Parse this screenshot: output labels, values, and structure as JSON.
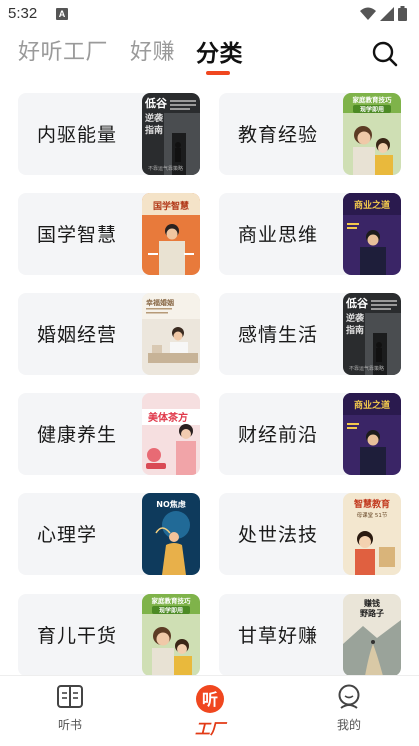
{
  "status": {
    "time": "5:32",
    "notif": "A"
  },
  "nav": {
    "tabs": [
      {
        "label": "好听工厂"
      },
      {
        "label": "好赚"
      },
      {
        "label": "分类"
      }
    ]
  },
  "categories": [
    {
      "label": "内驱能量",
      "cover": "low-valley"
    },
    {
      "label": "教育经验",
      "cover": "family-edu"
    },
    {
      "label": "国学智慧",
      "cover": "classics"
    },
    {
      "label": "商业思维",
      "cover": "business"
    },
    {
      "label": "婚姻经营",
      "cover": "couple"
    },
    {
      "label": "感情生活",
      "cover": "low-valley"
    },
    {
      "label": "健康养生",
      "cover": "beauty-tea"
    },
    {
      "label": "财经前沿",
      "cover": "business"
    },
    {
      "label": "心理学",
      "cover": "no-anxiety"
    },
    {
      "label": "处世法技",
      "cover": "wisdom-edu"
    },
    {
      "label": "育儿干货",
      "cover": "family-edu"
    },
    {
      "label": "甘草好赚",
      "cover": "money-road"
    }
  ],
  "covers": {
    "low_valley": {
      "title": "低谷逆袭指南",
      "sub": "不靠运气靠策略"
    },
    "family_edu": {
      "title": "家庭教育技巧",
      "sub": "现学即用"
    },
    "classics": {
      "title": "国学智慧"
    },
    "business": {
      "title": "商业之道"
    },
    "couple": {
      "title": "幸福婚姻"
    },
    "beauty_tea": {
      "title": "美体茶方"
    },
    "no_anxiety": {
      "title": "NO焦虑"
    },
    "wisdom_edu": {
      "title": "智慧教育",
      "sub": "母课堂 51节"
    },
    "money_road": {
      "title": "赚钱野路子"
    }
  },
  "bottom_nav": [
    {
      "label": "听书"
    },
    {
      "label": "工厂"
    },
    {
      "label": "我的"
    }
  ],
  "colors": {
    "accent": "#f0471f",
    "card_bg": "#f4f5f7"
  }
}
